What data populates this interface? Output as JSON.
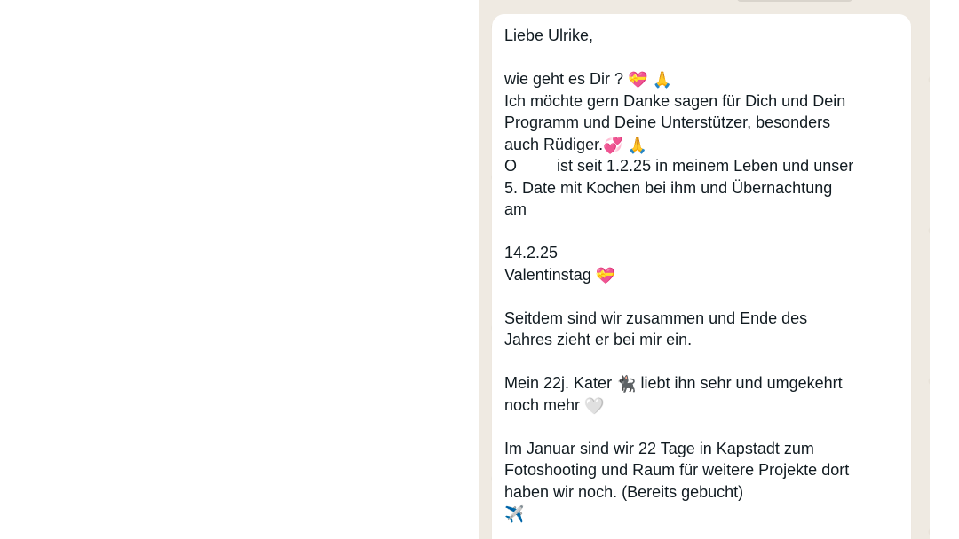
{
  "message": {
    "lines": {
      "l1": "Liebe Ulrike,",
      "l2_text": "wie geht es Dir ?",
      "l3": "Ich möchte gern Danke sagen für Dich und Dein",
      "l4": "Programm und Deine Unterstützer, besonders",
      "l5_text": "auch Rüdiger.",
      "l6_start": "O",
      "l6_end": " ist seit 1.2.25 in meinem Leben und unser",
      "l7": "5. Date mit Kochen bei ihm und Übernachtung",
      "l8": "am",
      "l9": "14.2.25",
      "l10_text": "Valentinstag",
      "l11": "Seitdem sind wir zusammen und Ende des",
      "l12": "Jahres zieht er bei mir ein.",
      "l13_start": "Mein 22j. Kater",
      "l13_end": " liebt ihn sehr und umgekehrt",
      "l14_text": "noch mehr",
      "l15": "Im Januar sind wir 22 Tage in Kapstadt zum",
      "l16": "Fotoshooting und Raum für weitere Projekte dort",
      "l17": "haben wir noch. (Bereits gebucht)"
    },
    "emoji": {
      "heart_ribbon": "💝",
      "folded_hands": "🙏",
      "two_hearts": "💞",
      "black_cat": "🐈‍⬛",
      "white_heart": "🤍",
      "airplane": "✈️"
    }
  }
}
